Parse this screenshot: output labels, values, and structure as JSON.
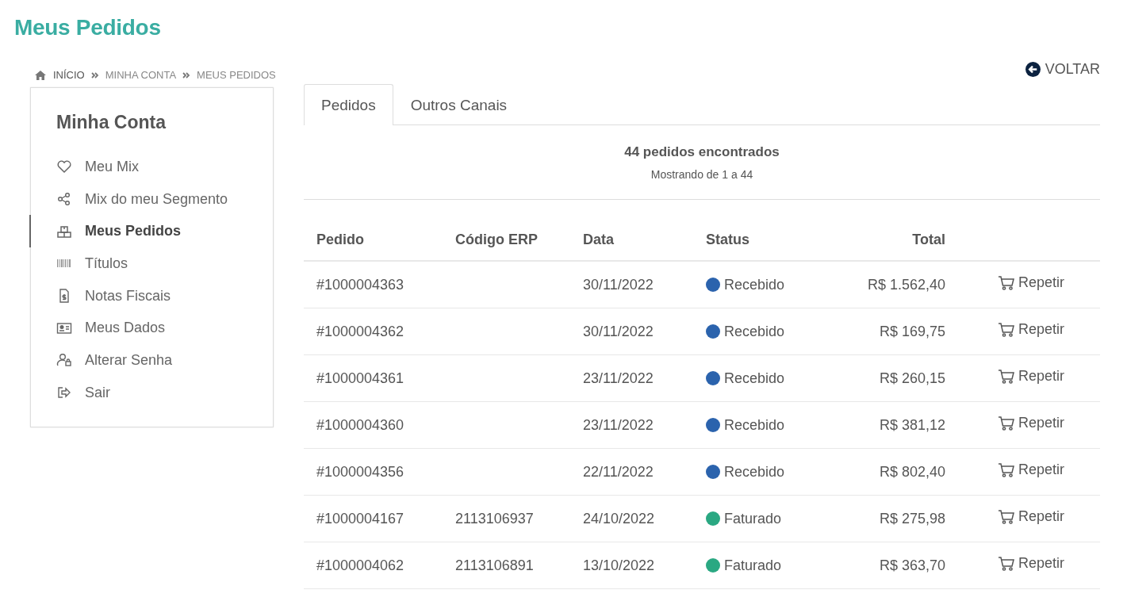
{
  "page_title": "Meus Pedidos",
  "breadcrumb": [
    "INÍCIO",
    "MINHA CONTA",
    "MEUS PEDIDOS"
  ],
  "back_link": "VOLTAR",
  "sidebar": {
    "title": "Minha Conta",
    "items": [
      {
        "label": "Meu Mix",
        "selected": false
      },
      {
        "label": "Mix do meu Segmento",
        "selected": false
      },
      {
        "label": "Meus Pedidos",
        "selected": true
      },
      {
        "label": "Títulos",
        "selected": false
      },
      {
        "label": "Notas Fiscais",
        "selected": false
      },
      {
        "label": "Meus Dados",
        "selected": false
      },
      {
        "label": "Alterar Senha",
        "selected": false
      },
      {
        "label": "Sair",
        "selected": false
      }
    ]
  },
  "tabs": [
    {
      "label": "Pedidos",
      "selected": true
    },
    {
      "label": "Outros Canais",
      "selected": false
    }
  ],
  "summary": {
    "count": "44 pedidos encontrados",
    "range": "Mostrando de 1 a 44"
  },
  "table": {
    "columns": [
      "Pedido",
      "Código ERP",
      "Data",
      "Status",
      "Total"
    ],
    "rows": [
      {
        "pedido": "#1000004363",
        "erp": "",
        "data": "30/11/2022",
        "status": "Recebido",
        "color": "#2b63ad",
        "total": "R$ 1.562,40",
        "action": "Repetir"
      },
      {
        "pedido": "#1000004362",
        "erp": "",
        "data": "30/11/2022",
        "status": "Recebido",
        "color": "#2b63ad",
        "total": "R$ 169,75",
        "action": "Repetir"
      },
      {
        "pedido": "#1000004361",
        "erp": "",
        "data": "23/11/2022",
        "status": "Recebido",
        "color": "#2b63ad",
        "total": "R$ 260,15",
        "action": "Repetir"
      },
      {
        "pedido": "#1000004360",
        "erp": "",
        "data": "23/11/2022",
        "status": "Recebido",
        "color": "#2b63ad",
        "total": "R$ 381,12",
        "action": "Repetir"
      },
      {
        "pedido": "#1000004356",
        "erp": "",
        "data": "22/11/2022",
        "status": "Recebido",
        "color": "#2b63ad",
        "total": "R$ 802,40",
        "action": "Repetir"
      },
      {
        "pedido": "#1000004167",
        "erp": "2113106937",
        "data": "24/10/2022",
        "status": "Faturado",
        "color": "#2aa882",
        "total": "R$ 275,98",
        "action": "Repetir"
      },
      {
        "pedido": "#1000004062",
        "erp": "2113106891",
        "data": "13/10/2022",
        "status": "Faturado",
        "color": "#2aa882",
        "total": "R$ 363,70",
        "action": "Repetir"
      }
    ]
  }
}
